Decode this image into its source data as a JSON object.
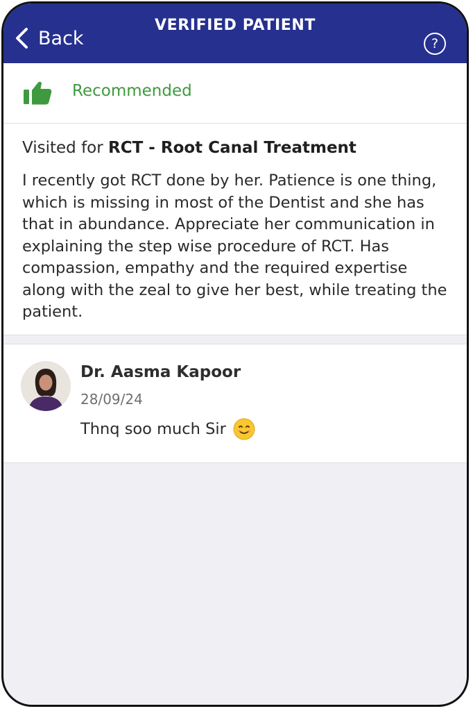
{
  "header": {
    "back_label": "Back",
    "title": "VERIFIED PATIENT",
    "help_symbol": "?",
    "background_color": "#26308f"
  },
  "recommendation": {
    "icon": "thumbs-up-icon",
    "label": "Recommended",
    "color": "#3f9a3f"
  },
  "review": {
    "visited_prefix": "Visited for",
    "treatment": "RCT - Root Canal Treatment",
    "text": "I recently got RCT done by her. Patience is one thing, which is missing in most of the Dentist and she has that in abundance. Appreciate her communication in explaining the step wise procedure of RCT. Has compassion, empathy and the required expertise along with the zeal to give her best, while treating the patient."
  },
  "reply": {
    "doctor_name": "Dr. Aasma Kapoor",
    "date": "28/09/24",
    "text": "Thnq soo much Sir",
    "emoji": "smiling-face-icon"
  }
}
